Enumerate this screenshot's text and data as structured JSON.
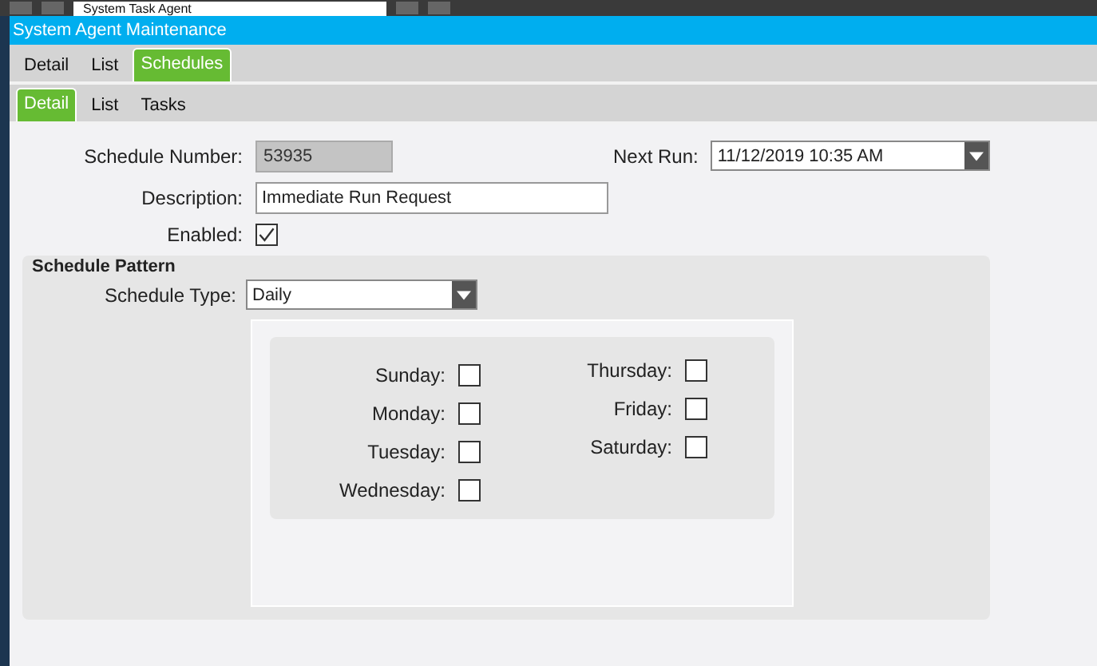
{
  "toolbar": {
    "field_value": "System Task Agent"
  },
  "window": {
    "title": "System Agent Maintenance"
  },
  "tabs": [
    {
      "label": "Detail",
      "selected": false
    },
    {
      "label": "List",
      "selected": false
    },
    {
      "label": "Schedules",
      "selected": true
    }
  ],
  "subtabs": [
    {
      "label": "Detail",
      "selected": true
    },
    {
      "label": "List",
      "selected": false
    },
    {
      "label": "Tasks",
      "selected": false
    }
  ],
  "form": {
    "schedule_number": {
      "label": "Schedule Number:",
      "value": "53935"
    },
    "description": {
      "label": "Description:",
      "value": "Immediate Run Request"
    },
    "enabled": {
      "label": "Enabled:",
      "checked": true
    },
    "next_run": {
      "label": "Next Run:",
      "value": "11/12/2019 10:35 AM"
    }
  },
  "schedule_pattern": {
    "title": "Schedule Pattern",
    "schedule_type": {
      "label": "Schedule Type:",
      "value": "Daily"
    },
    "day_columns": [
      [
        {
          "label": "Sunday:",
          "checked": false
        },
        {
          "label": "Monday:",
          "checked": false
        },
        {
          "label": "Tuesday:",
          "checked": false
        },
        {
          "label": "Wednesday:",
          "checked": false
        }
      ],
      [
        {
          "label": "Thursday:",
          "checked": false
        },
        {
          "label": "Friday:",
          "checked": false
        },
        {
          "label": "Saturday:",
          "checked": false
        }
      ]
    ]
  }
}
